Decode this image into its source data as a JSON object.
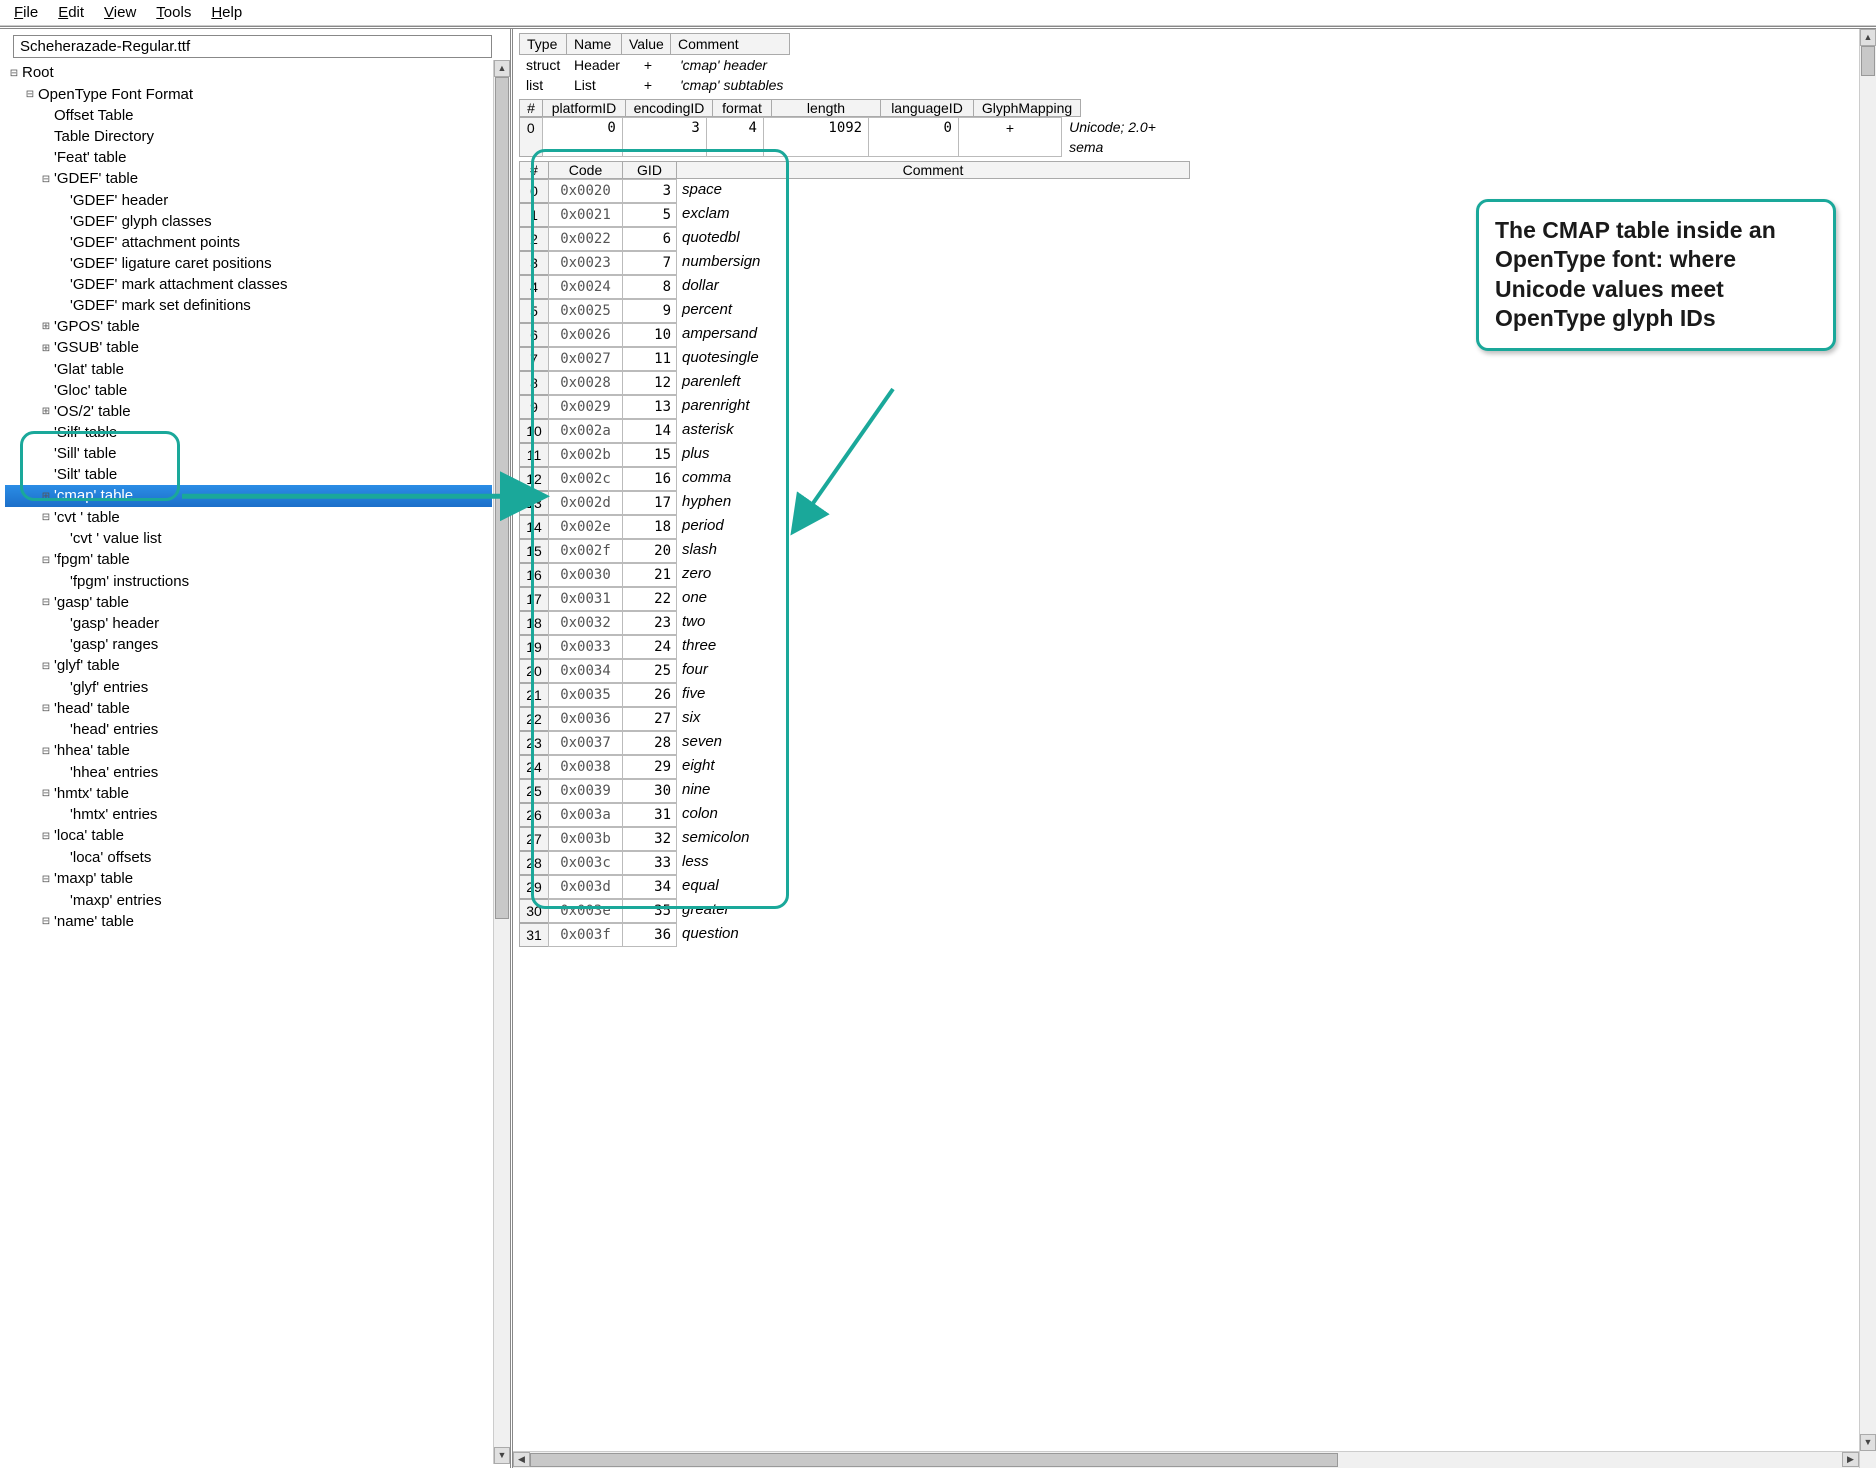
{
  "menu": [
    "File",
    "Edit",
    "View",
    "Tools",
    "Help"
  ],
  "filename": "Scheherazade-Regular.ttf",
  "tree": [
    {
      "d": 0,
      "t": "m",
      "label": "Root"
    },
    {
      "d": 1,
      "t": "m",
      "label": "OpenType Font Format"
    },
    {
      "d": 2,
      "t": "l",
      "label": "Offset Table"
    },
    {
      "d": 2,
      "t": "l",
      "label": "Table Directory"
    },
    {
      "d": 2,
      "t": "l",
      "label": "'Feat' table"
    },
    {
      "d": 2,
      "t": "m",
      "label": "'GDEF' table"
    },
    {
      "d": 3,
      "t": "l",
      "label": "'GDEF' header"
    },
    {
      "d": 3,
      "t": "l",
      "label": "'GDEF' glyph classes"
    },
    {
      "d": 3,
      "t": "l",
      "label": "'GDEF' attachment points"
    },
    {
      "d": 3,
      "t": "l",
      "label": "'GDEF' ligature caret positions"
    },
    {
      "d": 3,
      "t": "l",
      "label": "'GDEF' mark attachment classes"
    },
    {
      "d": 3,
      "t": "l",
      "label": "'GDEF' mark set definitions"
    },
    {
      "d": 2,
      "t": "p",
      "label": "'GPOS' table"
    },
    {
      "d": 2,
      "t": "p",
      "label": "'GSUB' table"
    },
    {
      "d": 2,
      "t": "l",
      "label": "'Glat' table"
    },
    {
      "d": 2,
      "t": "l",
      "label": "'Gloc' table"
    },
    {
      "d": 2,
      "t": "p",
      "label": "'OS/2' table"
    },
    {
      "d": 2,
      "t": "l",
      "label": "'Silf' table"
    },
    {
      "d": 2,
      "t": "l",
      "label": "'Sill' table"
    },
    {
      "d": 2,
      "t": "l",
      "label": "'Silt' table"
    },
    {
      "d": 2,
      "t": "p",
      "label": "'cmap' table",
      "sel": true
    },
    {
      "d": 2,
      "t": "m",
      "label": "'cvt ' table"
    },
    {
      "d": 3,
      "t": "l",
      "label": "'cvt ' value list"
    },
    {
      "d": 2,
      "t": "m",
      "label": "'fpgm' table"
    },
    {
      "d": 3,
      "t": "l",
      "label": "'fpgm' instructions"
    },
    {
      "d": 2,
      "t": "m",
      "label": "'gasp' table"
    },
    {
      "d": 3,
      "t": "l",
      "label": "'gasp' header"
    },
    {
      "d": 3,
      "t": "l",
      "label": "'gasp' ranges"
    },
    {
      "d": 2,
      "t": "m",
      "label": "'glyf' table"
    },
    {
      "d": 3,
      "t": "l",
      "label": "'glyf' entries"
    },
    {
      "d": 2,
      "t": "m",
      "label": "'head' table"
    },
    {
      "d": 3,
      "t": "l",
      "label": "'head' entries"
    },
    {
      "d": 2,
      "t": "m",
      "label": "'hhea' table"
    },
    {
      "d": 3,
      "t": "l",
      "label": "'hhea' entries"
    },
    {
      "d": 2,
      "t": "m",
      "label": "'hmtx' table"
    },
    {
      "d": 3,
      "t": "l",
      "label": "'hmtx' entries"
    },
    {
      "d": 2,
      "t": "m",
      "label": "'loca' table"
    },
    {
      "d": 3,
      "t": "l",
      "label": "'loca' offsets"
    },
    {
      "d": 2,
      "t": "m",
      "label": "'maxp' table"
    },
    {
      "d": 3,
      "t": "l",
      "label": "'maxp' entries"
    },
    {
      "d": 2,
      "t": "m",
      "label": "'name' table"
    }
  ],
  "propHeaders": [
    "Type",
    "Name",
    "Value",
    "Comment"
  ],
  "propRows": [
    {
      "type": "struct",
      "name": "Header",
      "value": "+",
      "comment": "'cmap' header"
    },
    {
      "type": "list",
      "name": "List",
      "value": "+",
      "comment": "'cmap' subtables"
    }
  ],
  "subHeaders": [
    "#",
    "platformID",
    "encodingID",
    "format",
    "length",
    "languageID",
    "GlyphMapping"
  ],
  "subRow": {
    "idx": "0",
    "platformID": "0",
    "encodingID": "3",
    "format": "4",
    "length": "1092",
    "languageID": "0",
    "GlyphMapping": "+",
    "comment": "Unicode; 2.0+ sema"
  },
  "glyphHeaders": [
    "#",
    "Code",
    "GID",
    "Comment"
  ],
  "glyphs": [
    {
      "i": 0,
      "code": "0x0020",
      "gid": 3,
      "c": "space"
    },
    {
      "i": 1,
      "code": "0x0021",
      "gid": 5,
      "c": "exclam"
    },
    {
      "i": 2,
      "code": "0x0022",
      "gid": 6,
      "c": "quotedbl"
    },
    {
      "i": 3,
      "code": "0x0023",
      "gid": 7,
      "c": "numbersign"
    },
    {
      "i": 4,
      "code": "0x0024",
      "gid": 8,
      "c": "dollar"
    },
    {
      "i": 5,
      "code": "0x0025",
      "gid": 9,
      "c": "percent"
    },
    {
      "i": 6,
      "code": "0x0026",
      "gid": 10,
      "c": "ampersand"
    },
    {
      "i": 7,
      "code": "0x0027",
      "gid": 11,
      "c": "quotesingle"
    },
    {
      "i": 8,
      "code": "0x0028",
      "gid": 12,
      "c": "parenleft"
    },
    {
      "i": 9,
      "code": "0x0029",
      "gid": 13,
      "c": "parenright"
    },
    {
      "i": 10,
      "code": "0x002a",
      "gid": 14,
      "c": "asterisk"
    },
    {
      "i": 11,
      "code": "0x002b",
      "gid": 15,
      "c": "plus"
    },
    {
      "i": 12,
      "code": "0x002c",
      "gid": 16,
      "c": "comma"
    },
    {
      "i": 13,
      "code": "0x002d",
      "gid": 17,
      "c": "hyphen"
    },
    {
      "i": 14,
      "code": "0x002e",
      "gid": 18,
      "c": "period"
    },
    {
      "i": 15,
      "code": "0x002f",
      "gid": 20,
      "c": "slash"
    },
    {
      "i": 16,
      "code": "0x0030",
      "gid": 21,
      "c": "zero"
    },
    {
      "i": 17,
      "code": "0x0031",
      "gid": 22,
      "c": "one"
    },
    {
      "i": 18,
      "code": "0x0032",
      "gid": 23,
      "c": "two"
    },
    {
      "i": 19,
      "code": "0x0033",
      "gid": 24,
      "c": "three"
    },
    {
      "i": 20,
      "code": "0x0034",
      "gid": 25,
      "c": "four"
    },
    {
      "i": 21,
      "code": "0x0035",
      "gid": 26,
      "c": "five"
    },
    {
      "i": 22,
      "code": "0x0036",
      "gid": 27,
      "c": "six"
    },
    {
      "i": 23,
      "code": "0x0037",
      "gid": 28,
      "c": "seven"
    },
    {
      "i": 24,
      "code": "0x0038",
      "gid": 29,
      "c": "eight"
    },
    {
      "i": 25,
      "code": "0x0039",
      "gid": 30,
      "c": "nine"
    },
    {
      "i": 26,
      "code": "0x003a",
      "gid": 31,
      "c": "colon"
    },
    {
      "i": 27,
      "code": "0x003b",
      "gid": 32,
      "c": "semicolon"
    },
    {
      "i": 28,
      "code": "0x003c",
      "gid": 33,
      "c": "less"
    },
    {
      "i": 29,
      "code": "0x003d",
      "gid": 34,
      "c": "equal"
    },
    {
      "i": 30,
      "code": "0x003e",
      "gid": 35,
      "c": "greater"
    },
    {
      "i": 31,
      "code": "0x003f",
      "gid": 36,
      "c": "question"
    }
  ],
  "callout": "The CMAP table inside an OpenType font: where Unicode values meet OpenType glyph IDs"
}
